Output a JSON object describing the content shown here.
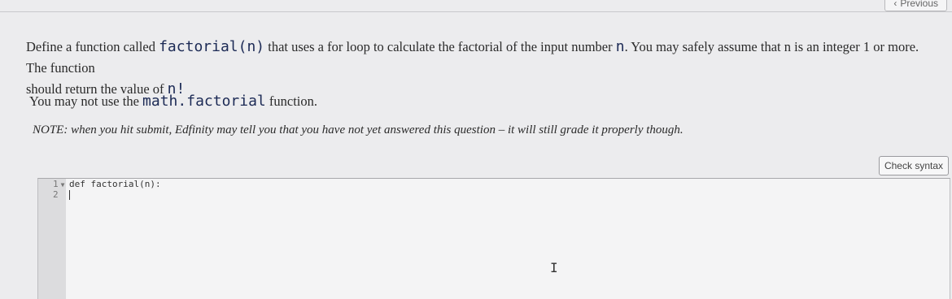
{
  "nav": {
    "previous_label": "Previous"
  },
  "question": {
    "p1_before": "Define a function called ",
    "p1_code1": "factorial(n)",
    "p1_after": " that uses a for loop to calculate the factorial of the input number ",
    "p1_code2": "n",
    "p1_after2": ". You may safely assume that n is an integer 1 or more. The function",
    "p1_line2": "should return the value of ",
    "p1_code3": "n!",
    "p2_before": "You may not use the ",
    "p2_code": "math.factorial",
    "p2_after": " function.",
    "note": "NOTE: when you hit submit, Edfinity may tell you that you have not yet answered this question – it will still grade it properly though."
  },
  "toolbar": {
    "check_syntax_label": "Check syntax"
  },
  "editor": {
    "line_numbers": [
      "1",
      "2"
    ],
    "lines": [
      "def factorial(n):",
      ""
    ]
  }
}
